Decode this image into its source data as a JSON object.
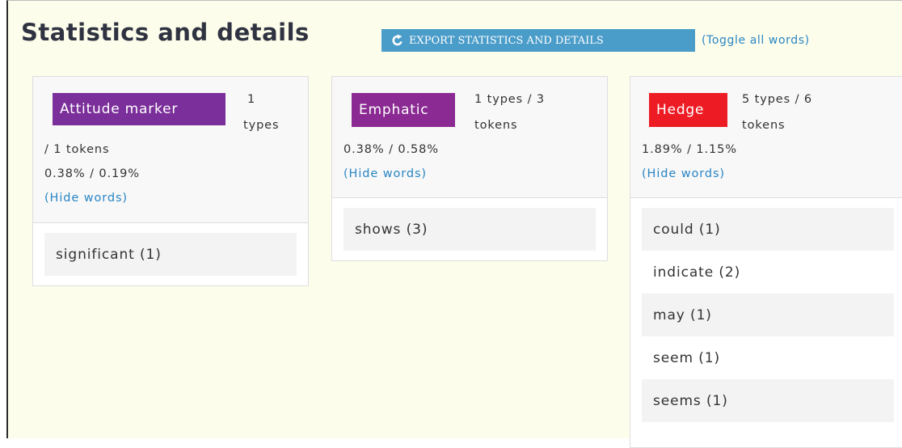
{
  "header": {
    "title": "Statistics and details",
    "export_label": "EXPORT STATISTICS AND DETAILS",
    "toggle_label": "(Toggle all words)"
  },
  "icons": {
    "export": "external-share-icon"
  },
  "colors": {
    "attitude_marker": "#7b2f9a",
    "emphatic": "#8a2a92",
    "hedge": "#ed1c24",
    "link": "#2a86c4",
    "export_button": "#4a9cc9"
  },
  "cards": [
    {
      "label": "Attitude marker",
      "types_text": "1",
      "types_text_2": "types",
      "tokens_text": "/ 1 tokens",
      "percent": "0.38% / 0.19%",
      "hide_label": "(Hide words)",
      "words": [
        "significant (1)"
      ]
    },
    {
      "label": "Emphatic",
      "types_text": "1 types / 3",
      "types_text_2": "tokens",
      "percent": "0.38% / 0.58%",
      "hide_label": "(Hide words)",
      "words": [
        "shows (3)"
      ]
    },
    {
      "label": "Hedge",
      "types_text": "5 types / 6",
      "types_text_2": "tokens",
      "percent": "1.89% / 1.15%",
      "hide_label": "(Hide words)",
      "words": [
        "could (1)",
        "indicate (2)",
        "may (1)",
        "seem (1)",
        "seems (1)"
      ]
    }
  ]
}
